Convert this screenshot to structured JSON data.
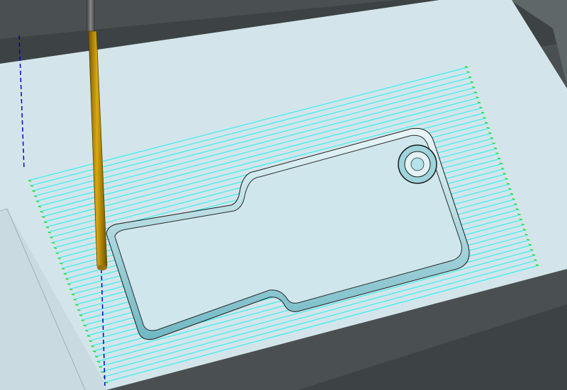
{
  "viewport": {
    "scene": "cnc-toolpath-simulation",
    "colors": {
      "background": "#4a5051",
      "background_dark": "#3d4344",
      "background_right": "#5f6869",
      "stock_top": "#d3e5ea",
      "stock_side": "#cfdfe4",
      "toolpath": "#19f2f2",
      "toolpath_end": "#22e022",
      "tool_shank": "#b8860b",
      "tool_holder": "#5b5b5b",
      "guide_line": "#0000cc",
      "part_surface": "#cfe7ec",
      "part_wall": "#7cc8d4"
    },
    "icons": [
      "end-mill-tool-icon"
    ]
  }
}
